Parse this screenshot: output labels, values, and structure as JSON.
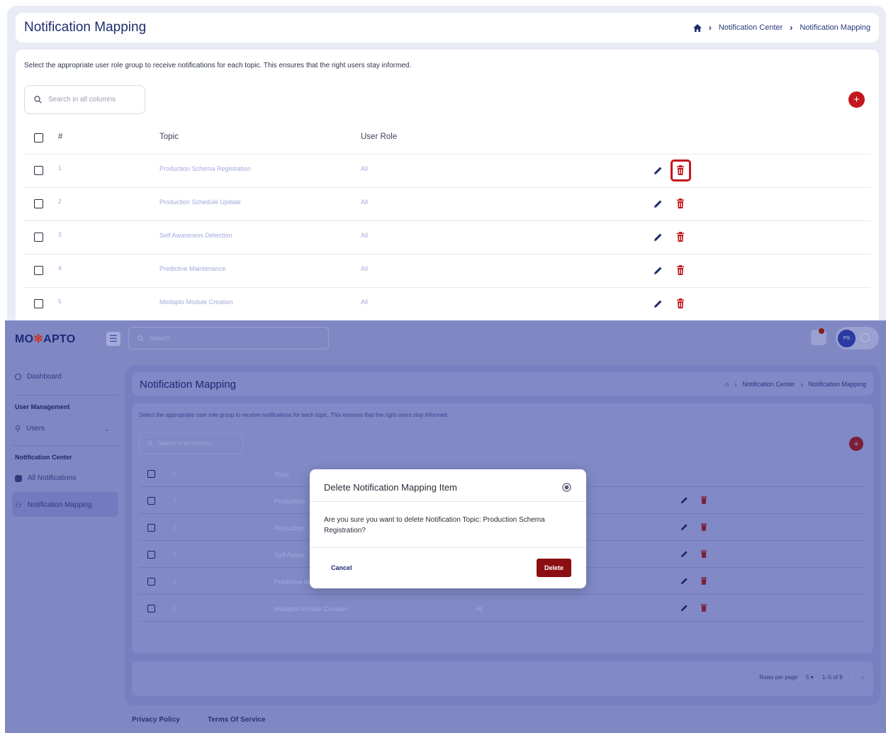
{
  "zoom_panel": {
    "title": "Notification Mapping",
    "breadcrumb": [
      "Notification Center",
      "Notification Mapping"
    ],
    "description": "Select the appropriate user role group to receive notifications for each topic. This ensures that the right users stay informed.",
    "search_placeholder": "Search in all columns",
    "add_label": "+",
    "columns": {
      "num": "#",
      "topic": "Topic",
      "role": "User Role"
    },
    "rows": [
      {
        "num": "1",
        "topic": "Production Schema Registration",
        "role": "All"
      },
      {
        "num": "2",
        "topic": "Production Schedule Update",
        "role": "All"
      },
      {
        "num": "3",
        "topic": "Self Awareness Detection",
        "role": "All"
      },
      {
        "num": "4",
        "topic": "Predictive Maintenance",
        "role": "All"
      },
      {
        "num": "5",
        "topic": "Modapto Module Creation",
        "role": "All"
      }
    ]
  },
  "app": {
    "logo_left": "MO",
    "logo_right": "APTO",
    "search_placeholder": "Search",
    "avatar_initials": "PS",
    "sidebar": {
      "dashboard": "Dashboard",
      "user_mgmt_header": "User Management",
      "users": "Users",
      "notif_header": "Notification Center",
      "all_notifications": "All Notifications",
      "notification_mapping": "Notification Mapping"
    },
    "page_title": "Notification Mapping",
    "breadcrumb": [
      "Notification Center",
      "Notification Mapping"
    ],
    "description": "Select the appropriate user role group to receive notifications for each topic. This ensures that the right users stay informed.",
    "search_placeholder_table": "Search in all columns",
    "columns": {
      "num": "#",
      "topic": "Topic"
    },
    "rows": [
      {
        "num": "1",
        "topic": "Production",
        "role": ""
      },
      {
        "num": "2",
        "topic": "Production",
        "role": ""
      },
      {
        "num": "3",
        "topic": "Self Aware",
        "role": ""
      },
      {
        "num": "4",
        "topic": "Predictive M",
        "role": ""
      },
      {
        "num": "5",
        "topic": "Modapto Module Creation",
        "role": "All"
      }
    ],
    "pagination": {
      "rows_per_page_label": "Rows per page",
      "rows_per_page": "5",
      "range": "1–5 of 8"
    },
    "footer": {
      "privacy": "Privacy Policy",
      "terms": "Terms Of Service"
    }
  },
  "modal": {
    "title": "Delete Notification Mapping Item",
    "body": "Are you sure you want to delete Notification Topic: Production Schema Registration?",
    "cancel": "Cancel",
    "delete": "Delete"
  },
  "colors": {
    "accent": "#c4161c",
    "primary": "#1f2d6e",
    "overlay": "#8088c4",
    "delete_btn": "#8b0f12"
  }
}
